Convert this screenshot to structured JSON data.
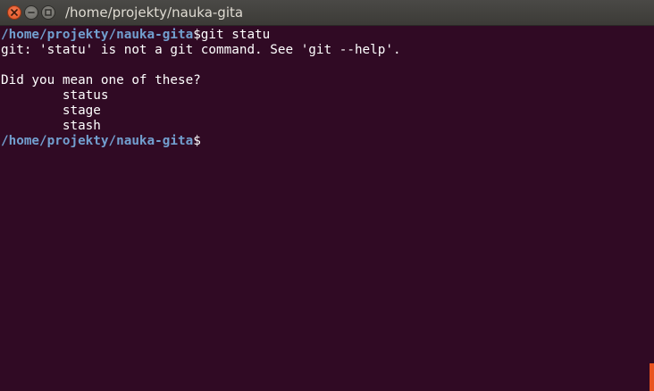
{
  "window": {
    "title": "/home/projekty/nauka-gita"
  },
  "terminal": {
    "prompt_path": "/home/projekty/nauka-gita",
    "prompt_symbol": "$",
    "command": "git statu",
    "error_line": "git: 'statu' is not a git command. See 'git --help'.",
    "blank_line": "",
    "suggestion_header": "Did you mean one of these?",
    "suggestions": [
      "        status",
      "        stage",
      "        stash"
    ],
    "final_prompt_path": "/home/projekty/nauka-gita",
    "final_prompt_symbol": "$"
  },
  "colors": {
    "background": "#300a24",
    "prompt": "#729fcf",
    "text": "#ffffff",
    "accent": "#e95420"
  }
}
